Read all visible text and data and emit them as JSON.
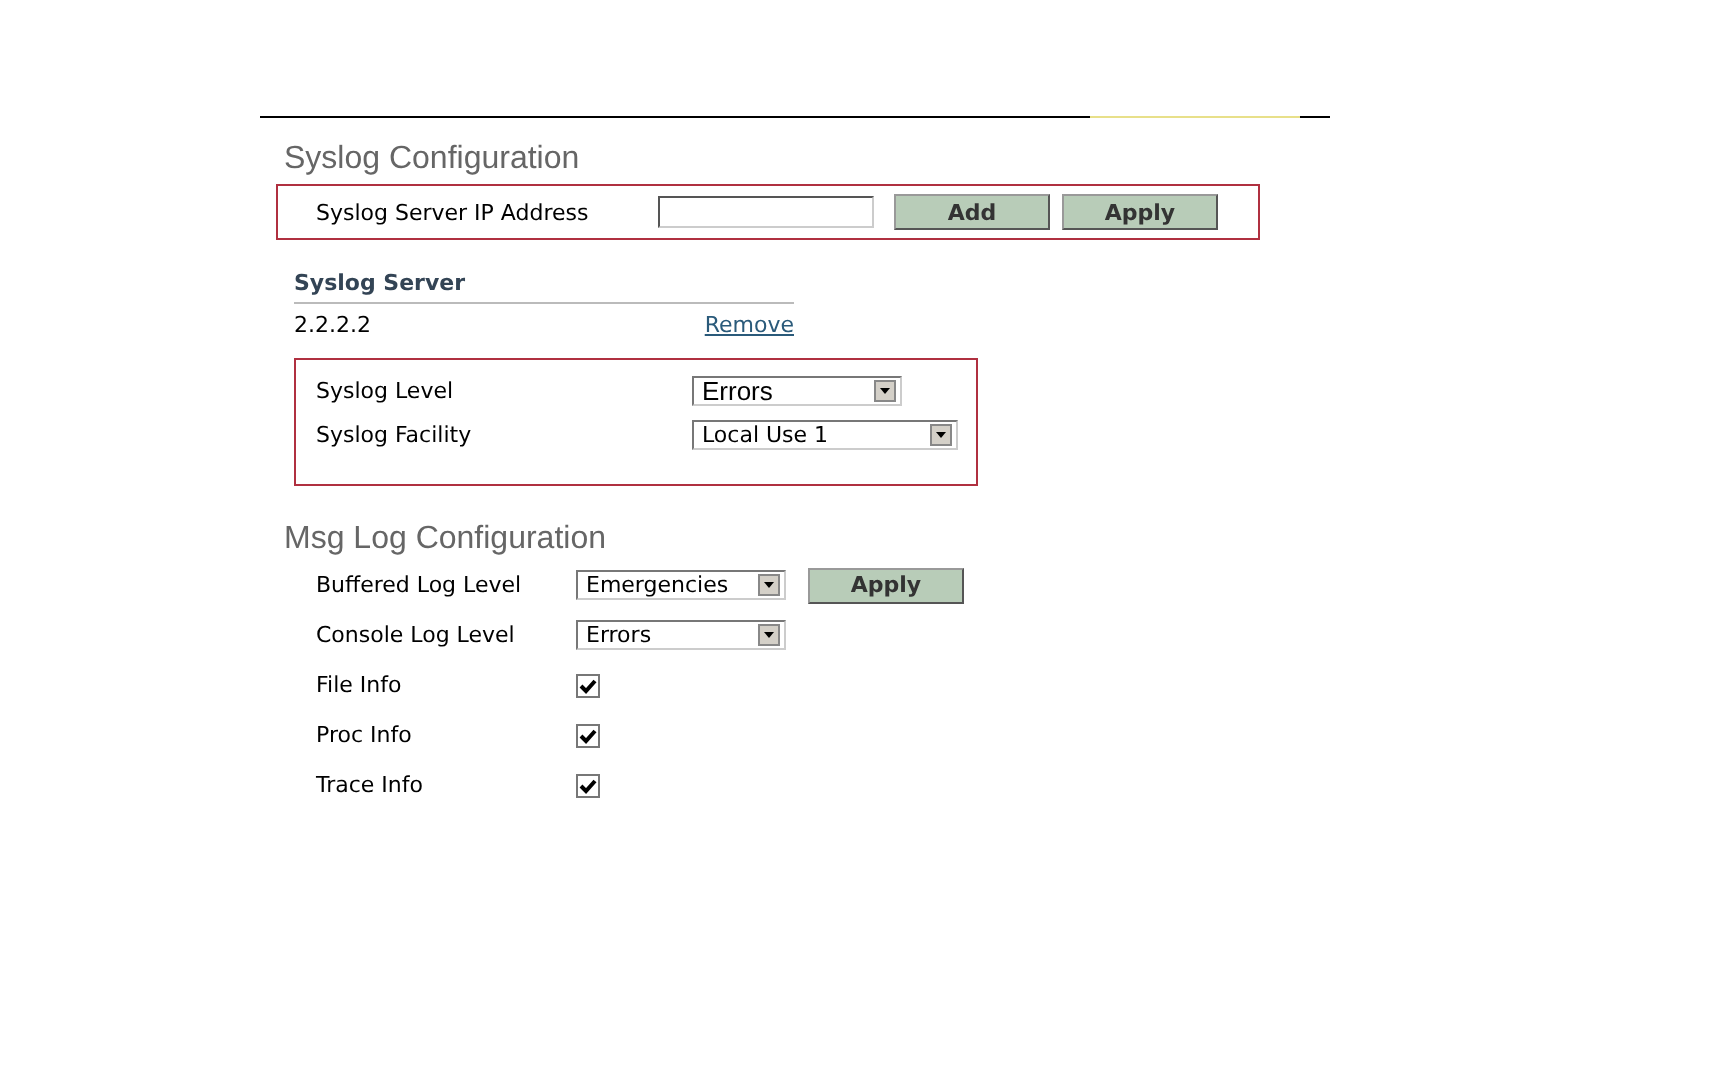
{
  "syslog": {
    "title": "Syslog Configuration",
    "ip_label": "Syslog Server IP Address",
    "buttons": [
      "Add",
      "Apply"
    ],
    "servers_heading": "Syslog Server",
    "servers": [
      {
        "address": "2.2.2.2",
        "action": "Remove"
      }
    ],
    "selects": [
      {
        "label": "Syslog Level",
        "value": "Errors"
      },
      {
        "label": "Syslog Facility",
        "value": "Local Use 1"
      }
    ]
  },
  "msglog": {
    "title": "Msg Log Configuration",
    "rows": [
      {
        "kind": "select",
        "label": "Buffered Log Level",
        "value": "Emergencies",
        "button": "Apply"
      },
      {
        "kind": "select",
        "label": "Console Log Level",
        "value": "Errors"
      },
      {
        "kind": "checkbox",
        "label": "File Info",
        "checked": true
      },
      {
        "kind": "checkbox",
        "label": "Proc Info",
        "checked": true
      },
      {
        "kind": "checkbox",
        "label": "Trace Info",
        "checked": true
      }
    ]
  }
}
